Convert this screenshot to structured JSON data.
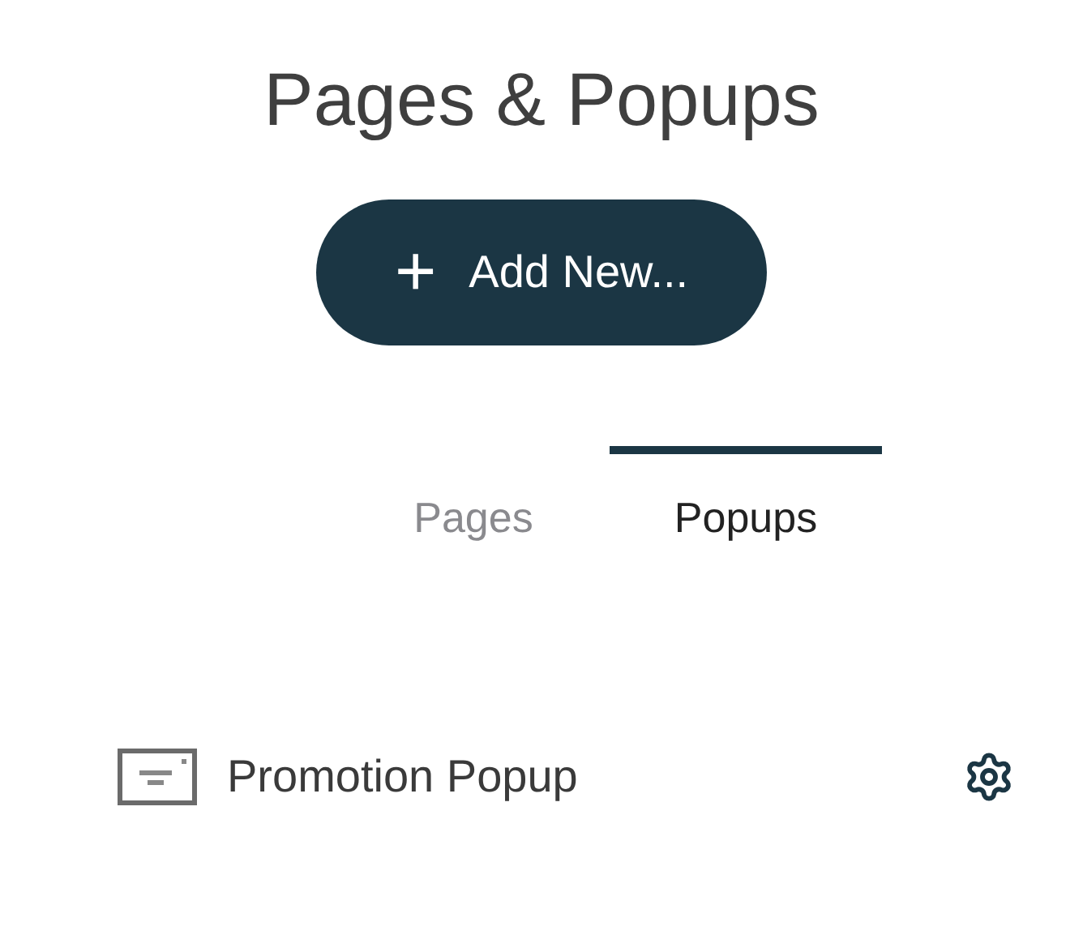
{
  "title": "Pages & Popups",
  "add_button": {
    "icon": "+",
    "label": "Add New..."
  },
  "tabs": [
    {
      "label": "Pages",
      "selected": false
    },
    {
      "label": "Popups",
      "selected": true
    }
  ],
  "items": [
    {
      "name": "Promotion Popup"
    }
  ]
}
